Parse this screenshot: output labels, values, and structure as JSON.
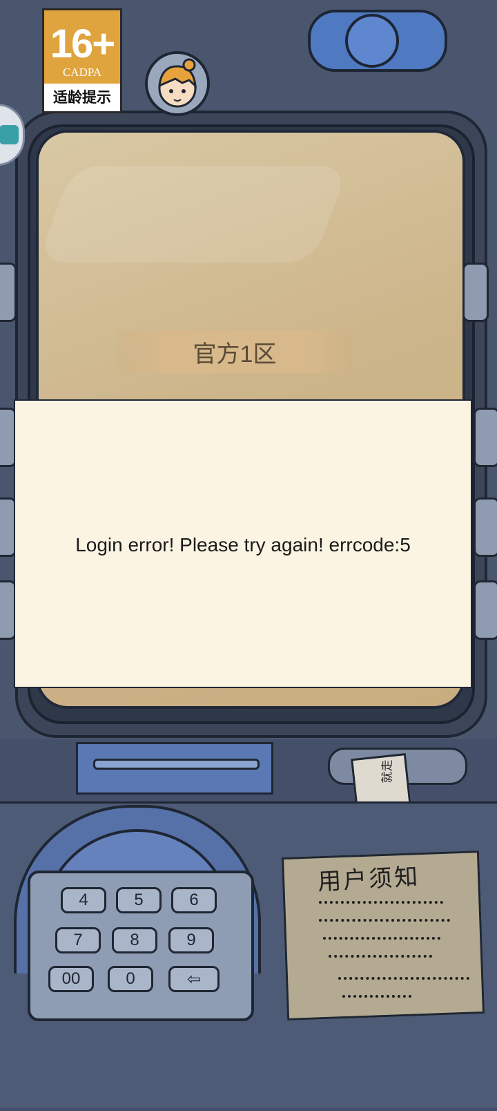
{
  "badge": {
    "age_rating": "16+",
    "org": "CADPA",
    "hint": "适龄提示"
  },
  "server": {
    "name": "官方1区"
  },
  "dialog": {
    "message": "Login error! Please try again! errcode:5"
  },
  "keypad": {
    "keys": [
      "4",
      "5",
      "6",
      "7",
      "8",
      "9",
      "00",
      "0",
      "⇦"
    ]
  },
  "notice": {
    "title": "用户须知"
  },
  "ticket": {
    "text": "就走"
  },
  "colors": {
    "dialog_bg": "#fcf4e3",
    "badge_orange": "#e0a43e",
    "machine_blue": "#4a566d"
  }
}
